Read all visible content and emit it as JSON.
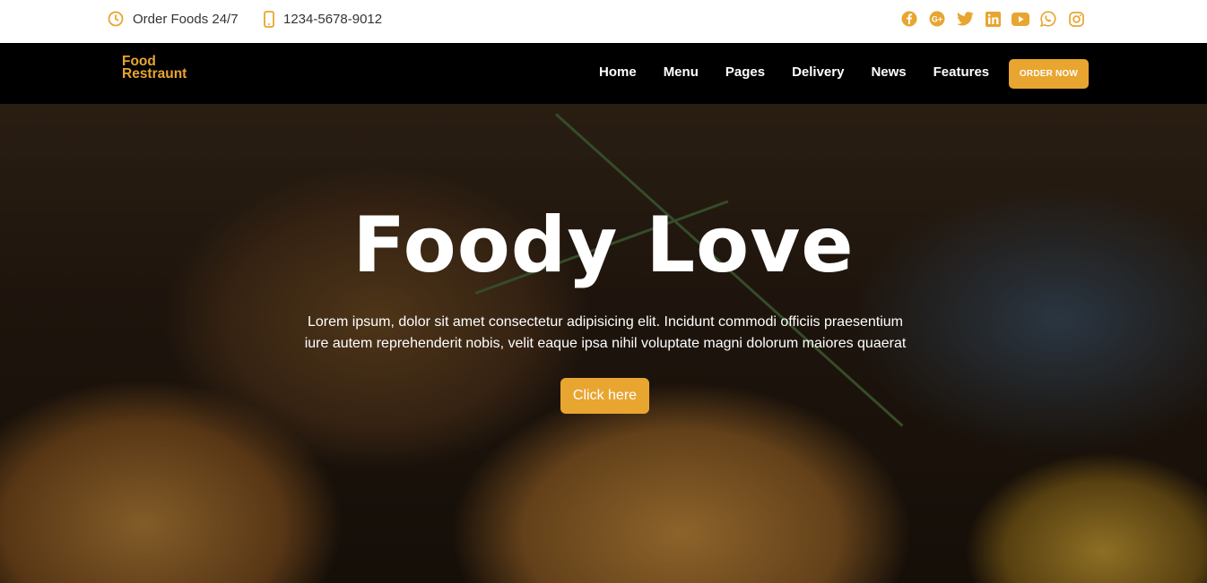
{
  "topbar": {
    "hours": "Order Foods 24/7",
    "phone": "1234-5678-9012",
    "socials": [
      "facebook-icon",
      "google-plus-icon",
      "twitter-icon",
      "linkedin-icon",
      "youtube-icon",
      "whatsapp-icon",
      "instagram-icon"
    ]
  },
  "nav": {
    "logo_line1": "Food",
    "logo_line2": "Restraunt",
    "links": [
      "Home",
      "Menu",
      "Pages",
      "Delivery",
      "News",
      "Features"
    ],
    "order_button": "ORDER NOW"
  },
  "hero": {
    "title": "Foody Love",
    "text": "Lorem ipsum, dolor sit amet consectetur adipisicing elit. Incidunt commodi officiis praesentium iure autem reprehenderit nobis, velit eaque ipsa nihil voluptate magni dolorum maiores quaerat",
    "button": "Click here"
  },
  "colors": {
    "accent": "#e8a530",
    "nav_bg": "#000000",
    "topbar_bg": "#ffffff"
  }
}
